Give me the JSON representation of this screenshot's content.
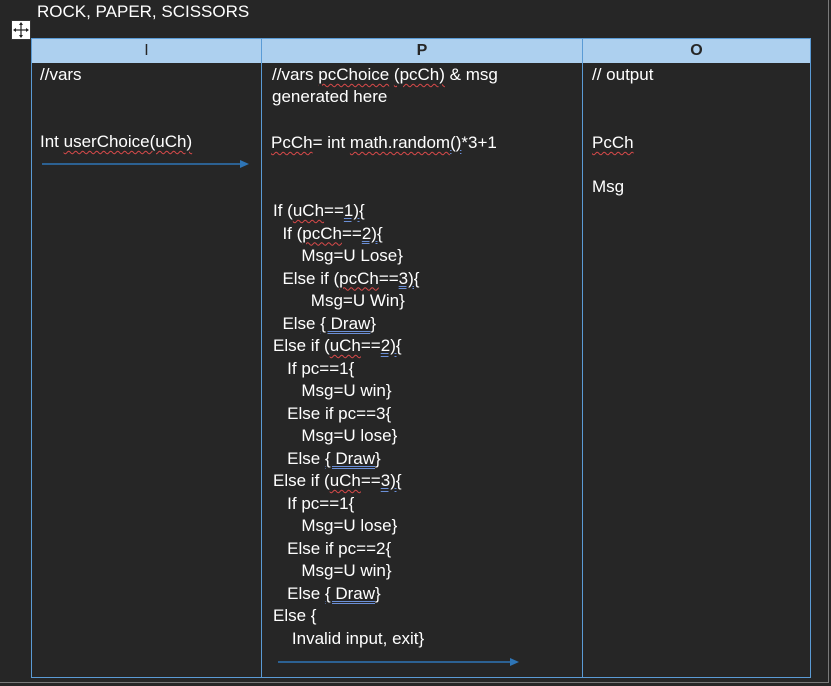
{
  "document": {
    "title": "ROCK, PAPER, SCISSORS"
  },
  "table": {
    "headers": {
      "input": "I",
      "process": "P",
      "output": "O"
    },
    "input_column": {
      "vars_comment": "//vars",
      "int_prefix": "Int ",
      "user_choice_decl": "userChoice(uCh)"
    },
    "process_column": {
      "comment_prefix": "//vars ",
      "comment_pcchoice": "pcChoice",
      "comment_space": " ",
      "comment_pcch": "(pcCh)",
      "comment_suffix": " & msg",
      "comment_line2": "generated here",
      "pcch_var": "PcCh",
      "pcch_assign_mid": "= int ",
      "pcch_math": "math.random",
      "pcch_parens": "()",
      "pcch_tail": "*3+1",
      "lines": [
        {
          "pre": "If (",
          "sq": "uCh",
          "mid": "==",
          "dbl": "1){",
          "post": ""
        },
        {
          "pre": "  If (",
          "sq": "pcCh",
          "mid": "==",
          "dbl": "2){",
          "post": ""
        },
        {
          "pre": "      Msg=U Lose}",
          "sq": "",
          "mid": "",
          "dbl": "",
          "post": ""
        },
        {
          "pre": "  Else if (",
          "sq": "pcCh",
          "mid": "==",
          "dbl": "3){",
          "post": ""
        },
        {
          "pre": "        Msg=U Win}",
          "sq": "",
          "mid": "",
          "dbl": "",
          "post": ""
        },
        {
          "pre": "  Else ",
          "sq": "",
          "mid": "",
          "dbl": "{ Draw",
          "post": "}"
        },
        {
          "pre": "Else if (",
          "sq": "uCh",
          "mid": "==",
          "dbl": "2){",
          "post": ""
        },
        {
          "pre": "   If pc==1{",
          "sq": "",
          "mid": "",
          "dbl": "",
          "post": ""
        },
        {
          "pre": "      Msg=U win}",
          "sq": "",
          "mid": "",
          "dbl": "",
          "post": ""
        },
        {
          "pre": "   Else if pc==3{",
          "sq": "",
          "mid": "",
          "dbl": "",
          "post": ""
        },
        {
          "pre": "      Msg=U lose}",
          "sq": "",
          "mid": "",
          "dbl": "",
          "post": ""
        },
        {
          "pre": "   Else ",
          "sq": "",
          "mid": "",
          "dbl": "{ Draw",
          "post": "}"
        },
        {
          "pre": "Else if (",
          "sq": "uCh",
          "mid": "==",
          "dbl": "3){",
          "post": ""
        },
        {
          "pre": "   If pc==1{",
          "sq": "",
          "mid": "",
          "dbl": "",
          "post": ""
        },
        {
          "pre": "      Msg=U lose}",
          "sq": "",
          "mid": "",
          "dbl": "",
          "post": ""
        },
        {
          "pre": "   Else if pc==2{",
          "sq": "",
          "mid": "",
          "dbl": "",
          "post": ""
        },
        {
          "pre": "      Msg=U win}",
          "sq": "",
          "mid": "",
          "dbl": "",
          "post": ""
        },
        {
          "pre": "   Else ",
          "sq": "",
          "mid": "",
          "dbl": "{ Draw",
          "post": "}"
        },
        {
          "pre": "Else {",
          "sq": "",
          "mid": "",
          "dbl": "",
          "post": ""
        },
        {
          "pre": "    Invalid input, exit}",
          "sq": "",
          "mid": "",
          "dbl": "",
          "post": ""
        }
      ]
    },
    "output_column": {
      "comment": "// output",
      "pcch": "PcCh",
      "msg": "Msg"
    }
  },
  "colors": {
    "background": "#262626",
    "header_fill": "#add0ef",
    "table_border": "#5b9bd5",
    "arrow": "#2e75b6",
    "spell_squiggle": "#d94a4a",
    "grammar_underline": "#6b8fd6"
  },
  "icons": {
    "move_handle": "table-move-handle-icon",
    "flow_arrow": "arrow-right-icon"
  }
}
